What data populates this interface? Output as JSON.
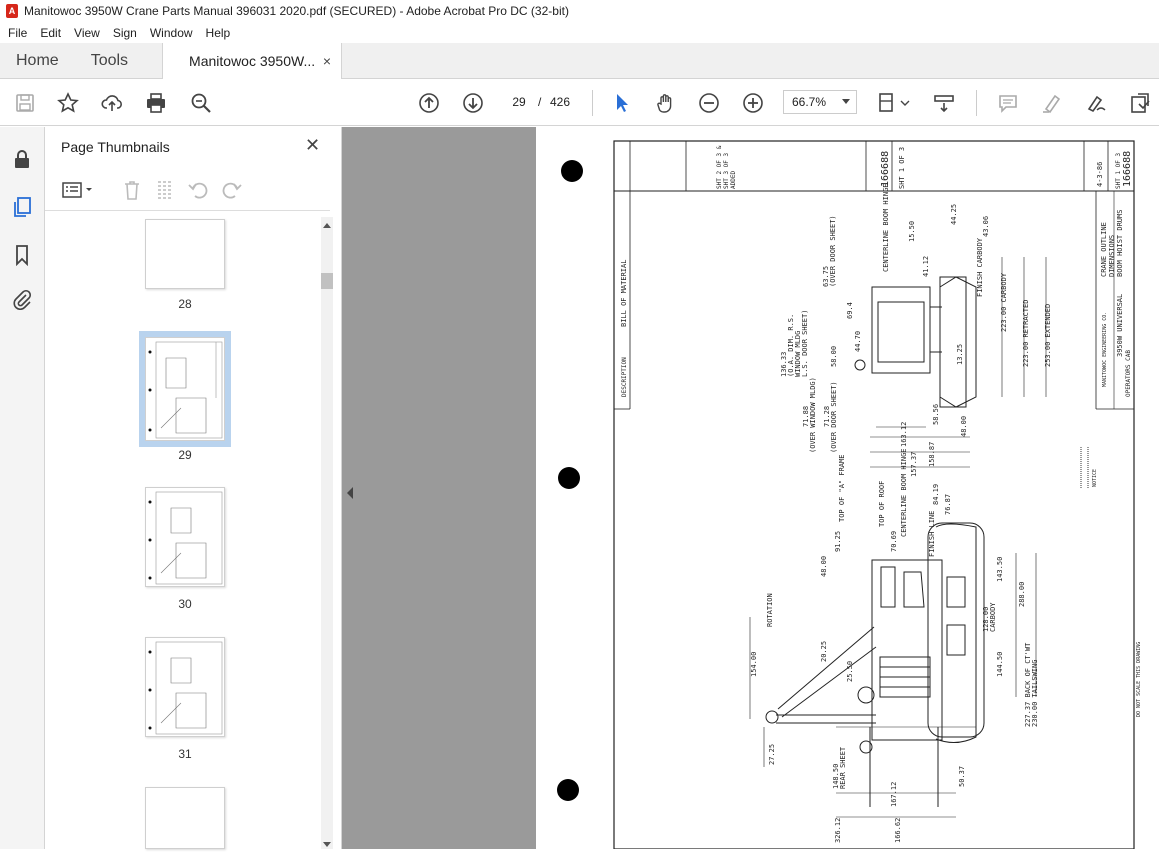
{
  "window": {
    "title": "Manitowoc 3950W Crane Parts Manual 396031 2020.pdf (SECURED) - Adobe Acrobat Pro DC (32-bit)"
  },
  "menu": [
    "File",
    "Edit",
    "View",
    "Sign",
    "Window",
    "Help"
  ],
  "tabs": {
    "home": "Home",
    "tools": "Tools",
    "document": "Manitowoc 3950W...",
    "close": "×"
  },
  "toolbar": {
    "current_page": "29",
    "page_separator": "/",
    "total_pages": "426",
    "zoom": "66.7%"
  },
  "thumbnails_panel": {
    "title": "Page Thumbnails",
    "close": "✕",
    "pages": [
      {
        "label": "28",
        "selected": false
      },
      {
        "label": "29",
        "selected": true
      },
      {
        "label": "30",
        "selected": false
      },
      {
        "label": "31",
        "selected": false
      }
    ]
  },
  "drawing": {
    "title_block": [
      "CRANE OUTLINE",
      "DIMENSIONS",
      "3950W UNIVERSAL",
      "BOOM HOIST DRUMS",
      "OPERATORS CAB"
    ],
    "drawing_number": "166688",
    "sheet": "SHT 1 OF 3",
    "date": "4-3-86",
    "company": "MANITOWOC ENGINEERING CO.",
    "revision_note": [
      "SHT 2 OF 3 &",
      "SHT 3 OF 3",
      "ADDED"
    ],
    "bill_of_material": "BILL OF MATERIAL",
    "description": "DESCRIPTION",
    "notice": "NOTICE",
    "do_not_scale": "DO NOT SCALE THIS DRAWING",
    "labels": {
      "centerline_boom_hinge": "CENTERLINE BOOM HINGE",
      "finish_carbody": "FINISH CARBODY",
      "over_door_sheet": "(OVER DOOR SHEET)",
      "over_window_mldg": "(OVER WINDOW MLDG)",
      "top_of_a_frame": "TOP OF \"A\" FRAME",
      "top_of_roof": "TOP OF ROOF",
      "finish_line": "FINISH LINE",
      "rotation": "ROTATION",
      "rear_sheet": "REAR SHEET",
      "carbody": "CARBODY",
      "retracted": "223.00 RETRACTED",
      "extended": "253.00 EXTENDED",
      "carbody_223": "223.00 CARBODY",
      "back_of_cwt": "227.37 BACK OF CT'WT",
      "tailswing": "230.00 TAILSWING",
      "window_note": [
        "136.33",
        "(O.A. DIM. R.S.",
        "WINDOW MLDG",
        "L.S. DOOR SHEET)"
      ]
    },
    "dims": [
      "63.75",
      "15.50",
      "44.25",
      "43.06",
      "41.12",
      "69.4",
      "58.00",
      "44.70",
      "13.25",
      "48.00",
      "58.56",
      "163.12",
      "71.88",
      "71.28",
      "158.87",
      "157.37",
      "84.19",
      "76.87",
      "91.25",
      "70.69",
      "48.00",
      "143.50",
      "288.00",
      "128.00",
      "20.25",
      "144.50",
      "154.00",
      "25.50",
      "27.25",
      "148.50",
      "167.12",
      "50.37",
      "166.62",
      "326.12"
    ]
  },
  "colors": {
    "accent_blue": "#2a6fd6",
    "selected_thumb": "#b9d3ee",
    "acrobat_red": "#d6271a"
  }
}
